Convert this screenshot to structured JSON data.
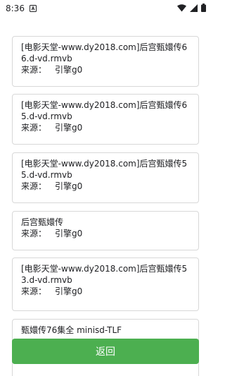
{
  "status_bar": {
    "time": "8:36",
    "app_icon": "text-a-icon",
    "icons": [
      "wifi-icon",
      "cellular-signal-icon",
      "battery-icon"
    ]
  },
  "results": [
    {
      "title": "[电影天堂-www.dy2018.com]后宫甄嬛传66.d-vd.rmvb",
      "source_label": "来源：",
      "source_value": "引擎g0"
    },
    {
      "title": "[电影天堂-www.dy2018.com]后宫甄嬛传65.d-vd.rmvb",
      "source_label": "来源：",
      "source_value": "引擎g0"
    },
    {
      "title": "[电影天堂-www.dy2018.com]后宫甄嬛传55.d-vd.rmvb",
      "source_label": "来源：",
      "source_value": "引擎g0"
    },
    {
      "title": "后宫甄嬛传",
      "source_label": "来源：",
      "source_value": "引擎g0"
    },
    {
      "title": "[电影天堂-www.dy2018.com]后宫甄嬛传53.d-vd.rmvb",
      "source_label": "来源：",
      "source_value": "引擎g0"
    },
    {
      "title": "甄嬛传76集全 minisd-TLF",
      "source_label": "",
      "source_value": ""
    }
  ],
  "back_button": {
    "label": "返回"
  },
  "colors": {
    "accent_green": "#4caf50",
    "card_border": "#d8d8d8",
    "text": "#202124"
  }
}
